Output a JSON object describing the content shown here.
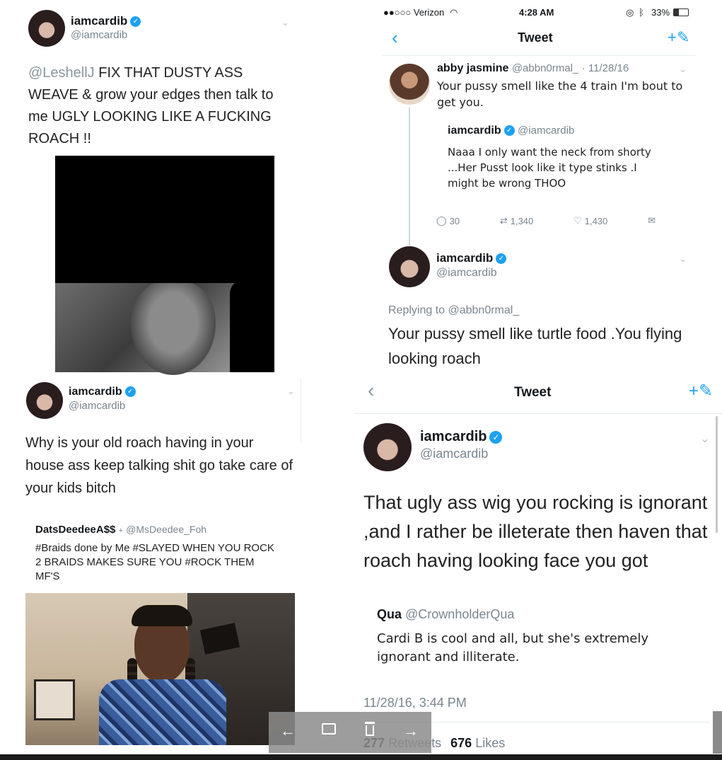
{
  "top_left": {
    "name": "iamcardib",
    "handle": "@iamcardib",
    "mention": "@LeshellJ",
    "text": " FIX THAT DUSTY ASS WEAVE & grow your edges then talk to me UGLY LOOKING LIKE A FUCKING ROACH !!"
  },
  "top_right": {
    "status_bar": {
      "carrier": "●●○○○ Verizon",
      "time": "4:28 AM",
      "battery": "33%"
    },
    "nav_title": "Tweet",
    "original": {
      "name": "abby jasmine",
      "handle": "@abbn0rmal_",
      "date": "· 11/28/16",
      "text": "Your pussy smell like the 4 train I'm bout to get you."
    },
    "reply": {
      "name": "iamcardib",
      "handle": "@iamcardib",
      "text": "Naaa I only want the neck from shorty ...Her Pusst look like it type stinks .I might be wrong THOO",
      "replies": "30",
      "retweets": "1,340",
      "likes": "1,430"
    },
    "main": {
      "name": "iamcardib",
      "handle": "@iamcardib",
      "replying_to": "Replying to @abbn0rmal_",
      "text": "Your pussy smell like turtle food .You flying looking roach"
    }
  },
  "bottom_left": {
    "name": "iamcardib",
    "handle": "@iamcardib",
    "text": "Why is your old roach having in your house ass keep talking shit go take care of your kids bitch",
    "quoted": {
      "name": "DatsDeedeeA$$",
      "handle": "@MsDeedee_Foh",
      "text": "#Braids done by Me #SLAYED WHEN YOU ROCK 2 BRAIDS MAKES SURE YOU #ROCK THEM MF'S"
    }
  },
  "bottom_right": {
    "nav_title": "Tweet",
    "name": "iamcardib",
    "handle": "@iamcardib",
    "text": "That ugly ass wig you rocking is ignorant ,and I rather be illeterate then haven that roach having looking face you got",
    "quoted": {
      "name": "Qua",
      "handle": "@CrownholderQua",
      "text": "Cardi B is cool and all, but she's extremely ignorant and illiterate."
    },
    "timestamp": "11/28/16, 3:44 PM",
    "retweets_count": "277",
    "retweets_label": "Retweets",
    "likes_count": "676",
    "likes_label": "Likes"
  },
  "toolbar": {
    "back_glyph": "←",
    "forward_glyph": "→"
  },
  "colors": {
    "verified": "#1da1f2",
    "handle": "#7a858f",
    "compose": "#1da1f2"
  }
}
